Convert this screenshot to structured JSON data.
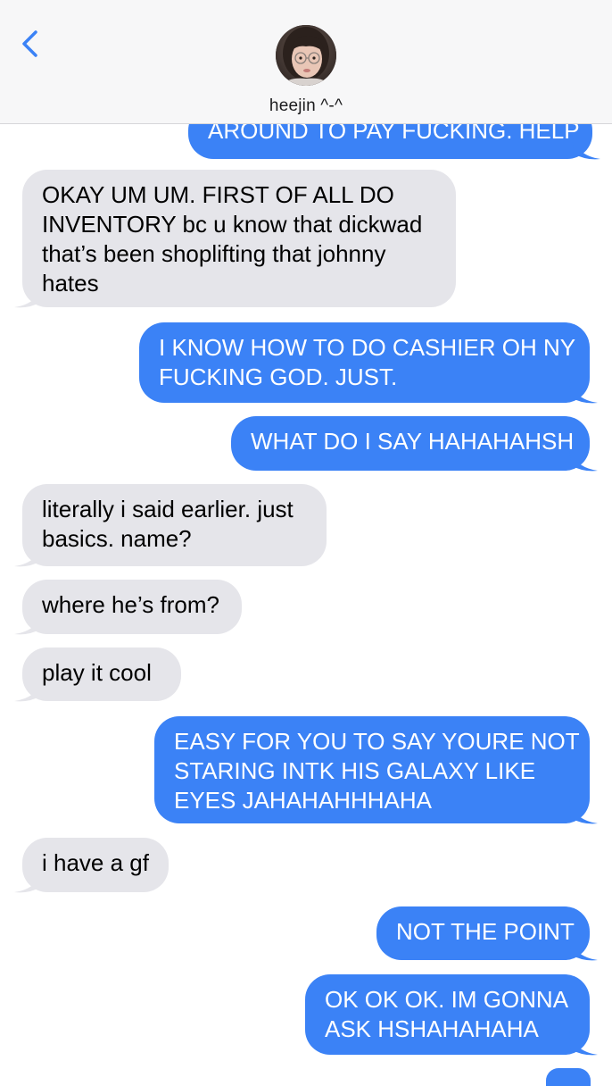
{
  "header": {
    "contact_name": "heejin ^-^"
  },
  "colors": {
    "outgoing_bubble": "#3b82f6",
    "incoming_bubble": "#e5e5ea",
    "accent": "#3b82f6",
    "header_bg": "#f7f7f8"
  },
  "icons": {
    "back": "chevron-left-icon"
  },
  "messages": [
    {
      "direction": "out",
      "lines": [
        "AROUND TO PAY FUCKING. HELP"
      ]
    },
    {
      "direction": "in",
      "lines": [
        "OKAY UM UM. FIRST OF ALL DO",
        "INVENTORY bc u know that dickwad",
        "that’s been shoplifting that johnny",
        "hates"
      ]
    },
    {
      "direction": "out",
      "lines": [
        "I KNOW HOW TO DO CASHIER OH NY",
        "FUCKING GOD. JUST."
      ]
    },
    {
      "direction": "out",
      "lines": [
        "WHAT DO I SAY HAHAHAHSH"
      ]
    },
    {
      "direction": "in",
      "lines": [
        "literally i said earlier. just",
        "basics. name?"
      ]
    },
    {
      "direction": "in",
      "lines": [
        "where he’s from?"
      ]
    },
    {
      "direction": "in",
      "lines": [
        "play it cool"
      ]
    },
    {
      "direction": "out",
      "lines": [
        "EASY FOR YOU TO SAY YOURE NOT",
        "STARING INTK HIS GALAXY LIKE",
        "EYES JAHAHAHHHAHA"
      ]
    },
    {
      "direction": "in",
      "lines": [
        "i have a gf"
      ]
    },
    {
      "direction": "out",
      "lines": [
        "NOT THE POINT"
      ]
    },
    {
      "direction": "out",
      "lines": [
        "OK OK OK. IM GONNA",
        "ASK HSHAHAHAHA"
      ]
    }
  ]
}
